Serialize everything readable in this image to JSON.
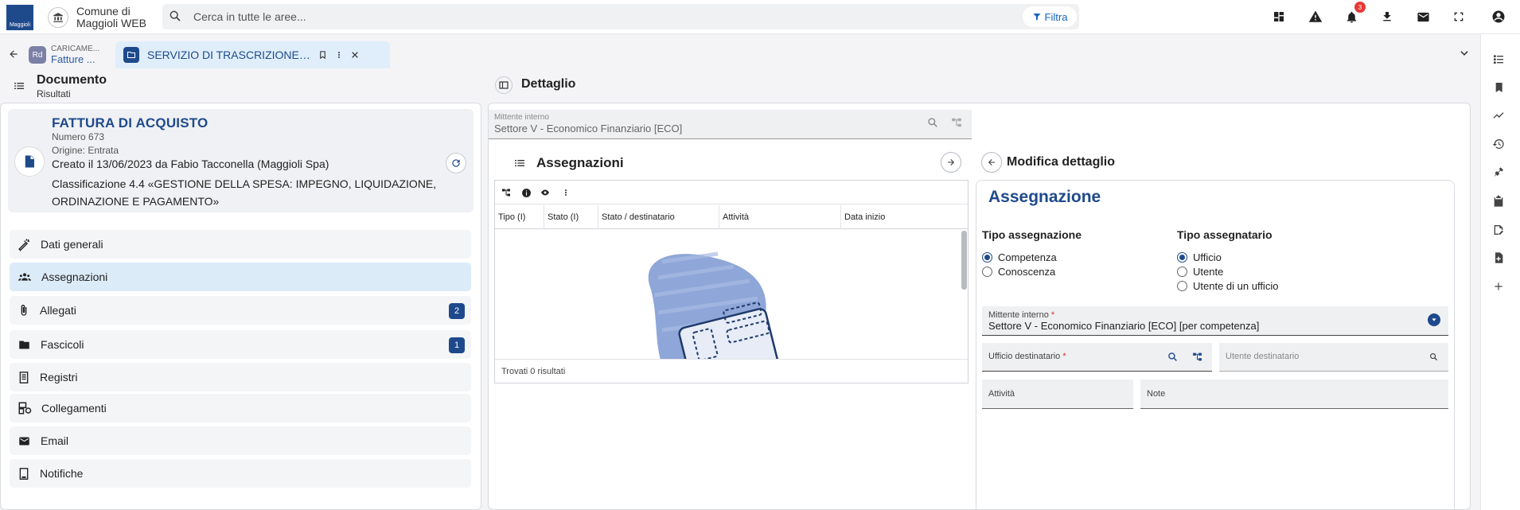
{
  "app": {
    "logo_text": "Maggioli",
    "title_line1": "Comune di",
    "title_line2": "Maggioli WEB",
    "search_placeholder": "Cerca in tutte le aree...",
    "filter_label": "Filtra",
    "notification_count": "3"
  },
  "tabs": [
    {
      "icon_text": "Rd",
      "subtitle": "CARICAME...",
      "label": "Fatture ..."
    },
    {
      "label": "SERVIZIO DI TRASCRIZIONE SE..."
    }
  ],
  "left": {
    "title": "Documento",
    "subtitle": "Risultati",
    "doc": {
      "title": "FATTURA DI ACQUISTO",
      "number": "Numero 673",
      "origin": "Origine: Entrata",
      "created": "Creato il 13/06/2023 da Fabio Tacconella (Maggioli Spa)",
      "classification": "Classificazione 4.4 «GESTIONE DELLA SPESA: IMPEGNO, LIQUIDAZIONE, ORDINAZIONE E PAGAMENTO»"
    },
    "menu": [
      {
        "label": "Dati generali",
        "icon": "wand-icon"
      },
      {
        "label": "Assegnazioni",
        "icon": "people-icon",
        "active": true
      },
      {
        "label": "Allegati",
        "icon": "paperclip-icon",
        "badge": "2"
      },
      {
        "label": "Fascicoli",
        "icon": "folder-icon",
        "badge": "1"
      },
      {
        "label": "Registri",
        "icon": "register-icon"
      },
      {
        "label": "Collegamenti",
        "icon": "link-doc-icon"
      },
      {
        "label": "Email",
        "icon": "mail-icon"
      },
      {
        "label": "Notifiche",
        "icon": "notification-doc-icon"
      }
    ]
  },
  "detail": {
    "title": "Dettaglio",
    "mittente_label": "Mittente interno",
    "mittente_value": "Settore V - Economico Finanziario [ECO]",
    "assegnazioni_title": "Assegnazioni",
    "columns": [
      "Tipo (I)",
      "Stato (I)",
      "Stato / destinatario",
      "Attività",
      "Data inizio"
    ],
    "footer": "Trovati 0 risultati"
  },
  "form": {
    "header": "Modifica dettaglio",
    "title": "Assegnazione",
    "tipo_assegnazione_label": "Tipo assegnazione",
    "tipo_assegnazione_options": [
      "Competenza",
      "Conoscenza"
    ],
    "tipo_assegnazione_selected": "Competenza",
    "tipo_assegnatario_label": "Tipo assegnatario",
    "tipo_assegnatario_options": [
      "Ufficio",
      "Utente",
      "Utente di un ufficio"
    ],
    "tipo_assegnatario_selected": "Ufficio",
    "mittente_label": "Mittente interno",
    "mittente_value": "Settore V - Economico Finanziario [ECO] [per competenza]",
    "ufficio_label": "Ufficio destinatario",
    "utente_label": "Utente destinatario",
    "attivita_label": "Attività",
    "note_label": "Note",
    "required_mark": "*"
  },
  "colors": {
    "primary": "#1e4a8c",
    "active_bg": "#dcebf8",
    "badge_red": "#e53935"
  }
}
